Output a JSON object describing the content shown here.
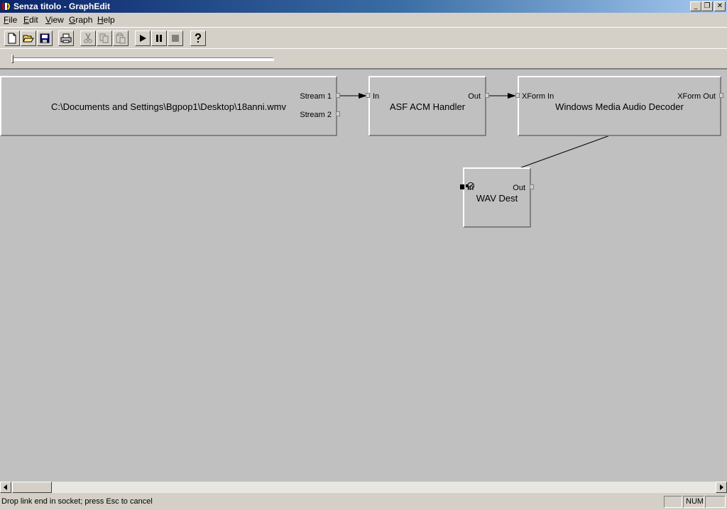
{
  "window": {
    "title": "Senza titolo - GraphEdit",
    "minimize_glyph": "_",
    "restore_glyph": "❐",
    "close_glyph": "✕"
  },
  "menu": [
    "File",
    "Edit",
    "View",
    "Graph",
    "Help"
  ],
  "toolbar": {
    "icons": [
      "new-icon",
      "open-icon",
      "save-icon",
      "print-icon",
      "cut-icon",
      "copy-icon",
      "paste-icon",
      "play-icon",
      "pause-icon",
      "stop-icon",
      "help-icon"
    ]
  },
  "graph": {
    "filters": {
      "source": {
        "name": "C:\\Documents and Settings\\Bgpop1\\Desktop\\18anni.wmv",
        "out_pins": [
          "Stream 1",
          "Stream 2"
        ]
      },
      "asf": {
        "name": "ASF ACM Handler",
        "in_pin": "In",
        "out_pin": "Out"
      },
      "wma": {
        "name": "Windows Media Audio Decoder",
        "in_pin": "XForm In",
        "out_pin": "XForm Out"
      },
      "wav": {
        "name": "WAV Dest",
        "in_pin": "In",
        "out_pin": "Out"
      }
    }
  },
  "status": {
    "message": "Drop link end in socket; press Esc to cancel",
    "num_indicator": "NUM"
  },
  "colors": {
    "titlebar_start": "#0a246a",
    "titlebar_end": "#a6caf0",
    "canvas_bg": "#c0c0c0",
    "chrome_bg": "#d4d0c8"
  }
}
